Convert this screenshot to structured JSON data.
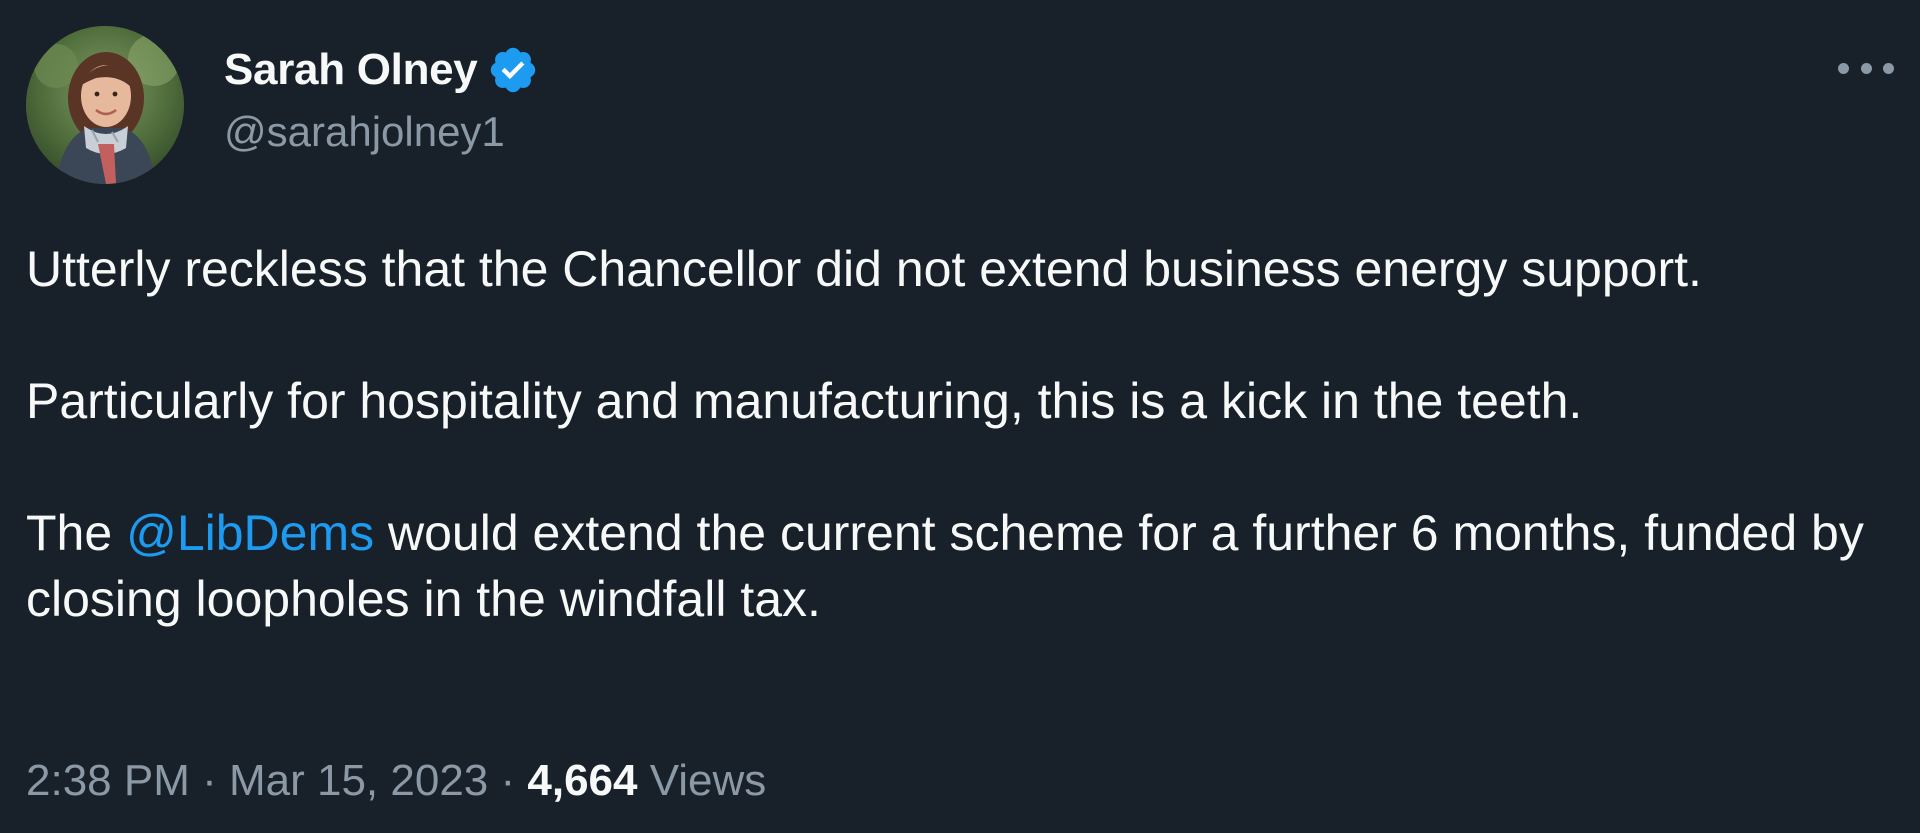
{
  "author": {
    "display_name": "Sarah Olney",
    "handle": "@sarahjolney1",
    "verified_icon": "verified-badge-icon",
    "avatar_icon": "profile-photo"
  },
  "tweet": {
    "text_1": "Utterly reckless that the Chancellor did not extend business energy support.",
    "text_2": "Particularly for hospitality and manufacturing, this is a kick in the teeth.",
    "text_3_before": "The ",
    "mention": "@LibDems",
    "text_3_after": " would extend the current scheme for a further 6 months, funded by closing loopholes in the windfall tax."
  },
  "meta": {
    "time": "2:38 PM",
    "separator": " · ",
    "date": "Mar 15, 2023",
    "views_count": "4,664",
    "views_label": " Views"
  },
  "colors": {
    "background": "#182029",
    "primary_text": "#f7f9f9",
    "secondary_text": "#8b98a5",
    "link": "#1d9bf0",
    "verified": "#1d9bf0"
  }
}
